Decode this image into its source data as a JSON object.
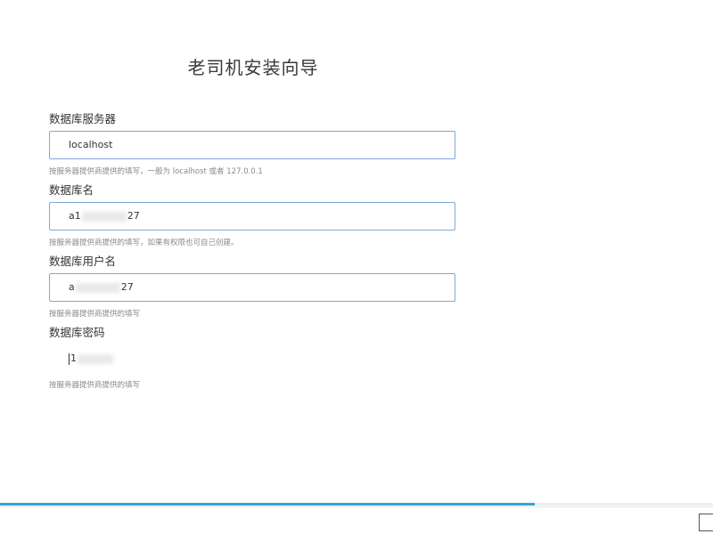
{
  "wizard": {
    "title": "老司机安装向导"
  },
  "fields": [
    {
      "label": "数据库服务器",
      "value": "localhost",
      "help": "按服务器提供商提供的填写，一般为 localhost 或者 127.0.0.1"
    },
    {
      "label": "数据库名",
      "value_prefix": "a1",
      "value_suffix": "27",
      "help": "按服务器提供商提供的填写，如果有权限也可自己创建。"
    },
    {
      "label": "数据库用户名",
      "value_prefix": "a",
      "value_suffix": "27",
      "help": "按服务器提供商提供的填写"
    },
    {
      "label": "数据库密码",
      "value_prefix": "1",
      "value_suffix": "",
      "help": "按服务器提供商提供的填写"
    }
  ],
  "progress": {
    "fraction": 0.75,
    "color": "#2aa7d6"
  }
}
